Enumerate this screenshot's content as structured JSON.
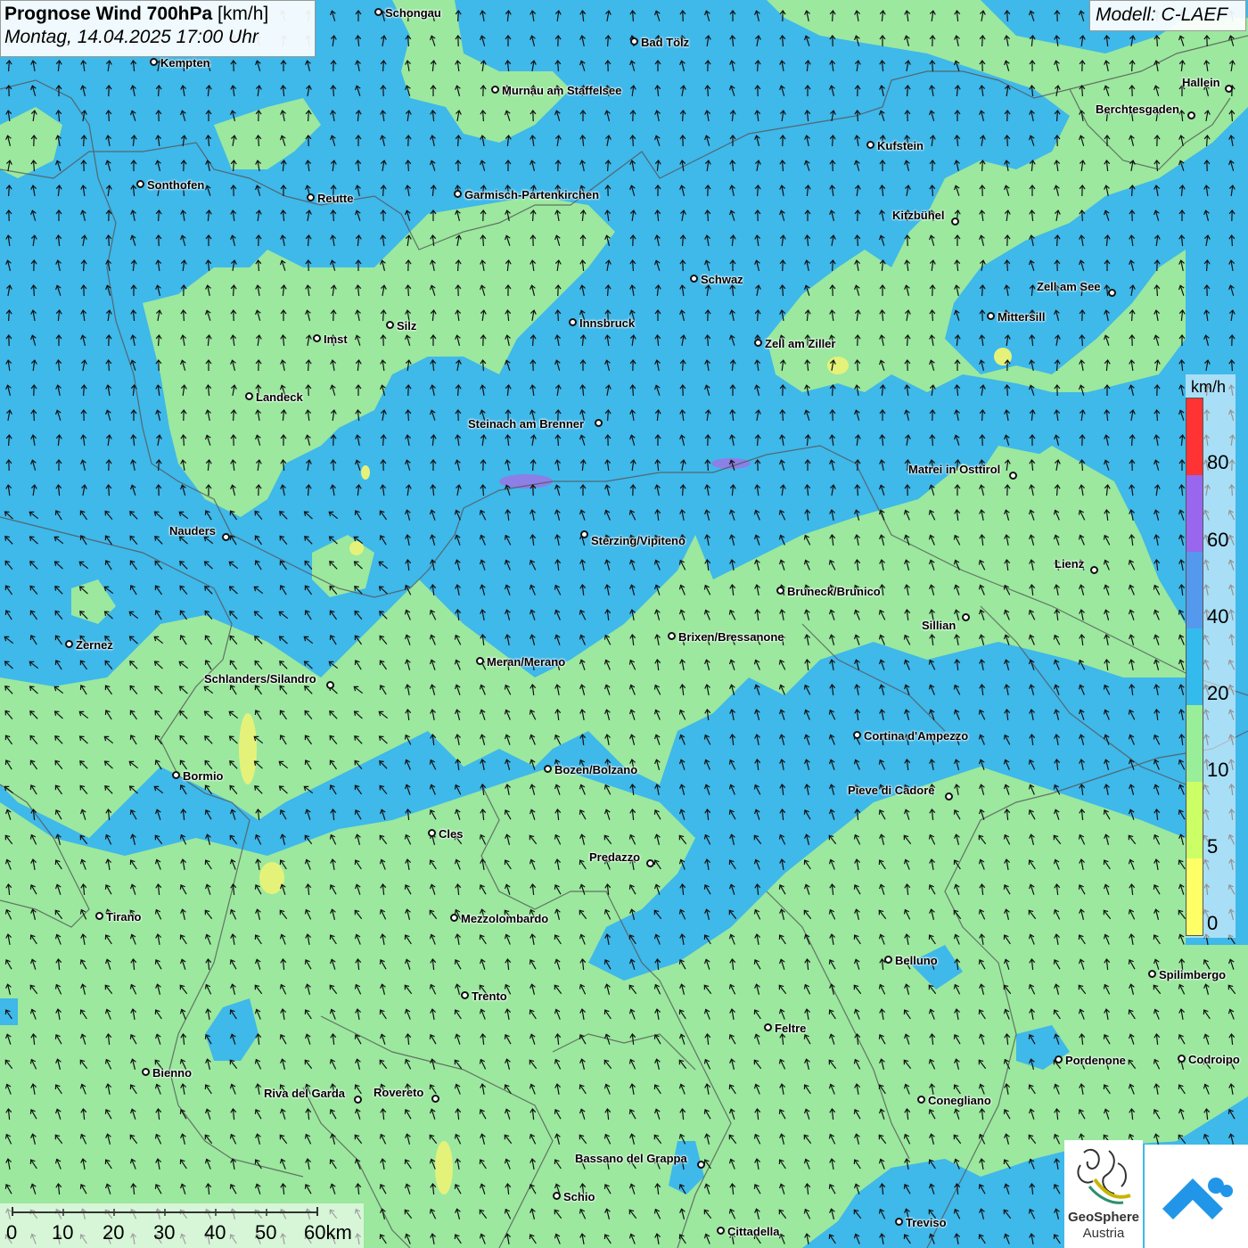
{
  "header": {
    "title_bold": "Prognose Wind 700hPa",
    "title_unit": " [km/h]",
    "subtitle": "Montag, 14.04.2025 17:00 Uhr"
  },
  "model": "Modell: C-LAEF",
  "legend": {
    "unit": "km/h",
    "ticks": [
      "0",
      "5",
      "10",
      "20",
      "40",
      "60",
      "80"
    ],
    "colors": [
      "#ffff66",
      "#ccff66",
      "#99ee99",
      "#33bbee",
      "#5599ee",
      "#9966ee",
      "#ff3333"
    ]
  },
  "scale": {
    "labels": [
      "0",
      "10",
      "20",
      "30",
      "40",
      "50",
      "60km"
    ]
  },
  "logo": {
    "name": "GeoSphere",
    "sub": "Austria"
  },
  "colors": {
    "water_blue": "#3fb8ea",
    "green_zone": "#9be89e",
    "yellow_zone": "#e5f27a",
    "purple_zone": "#7f7fe6",
    "border": "#555555"
  },
  "cities": [
    {
      "name": "Schongau"
    },
    {
      "name": "Bad Tölz"
    },
    {
      "name": "Kempten"
    },
    {
      "name": "Murnau am Staffelsee"
    },
    {
      "name": "Hallein"
    },
    {
      "name": "Berchtesgaden"
    },
    {
      "name": "Kufstein"
    },
    {
      "name": "Sonthofen"
    },
    {
      "name": "Reutte"
    },
    {
      "name": "Garmisch-Partenkirchen"
    },
    {
      "name": "Kitzbühel"
    },
    {
      "name": "Schwaz"
    },
    {
      "name": "Zell am See"
    },
    {
      "name": "Mittersill"
    },
    {
      "name": "Silz"
    },
    {
      "name": "Innsbruck"
    },
    {
      "name": "Imst"
    },
    {
      "name": "Zell am Ziller"
    },
    {
      "name": "Landeck"
    },
    {
      "name": "Steinach am Brenner"
    },
    {
      "name": "Matrei in Osttirol"
    },
    {
      "name": "Nauders"
    },
    {
      "name": "Sterzing/Vipiteno"
    },
    {
      "name": "Lienz"
    },
    {
      "name": "Bruneck/Brunico"
    },
    {
      "name": "Sillian"
    },
    {
      "name": "Zernez"
    },
    {
      "name": "Brixen/Bressanone"
    },
    {
      "name": "Meran/Merano"
    },
    {
      "name": "Schlanders/Silandro"
    },
    {
      "name": "Cortina d'Ampezzo"
    },
    {
      "name": "Bozen/Bolzano"
    },
    {
      "name": "Bormio"
    },
    {
      "name": "Pieve di Cadore"
    },
    {
      "name": "Cles"
    },
    {
      "name": "Predazzo"
    },
    {
      "name": "Tirano"
    },
    {
      "name": "Mezzolombardo"
    },
    {
      "name": "Belluno"
    },
    {
      "name": "Spilimbergo"
    },
    {
      "name": "Trento"
    },
    {
      "name": "Feltre"
    },
    {
      "name": "Pordenone"
    },
    {
      "name": "Codroipo"
    },
    {
      "name": "Bienno"
    },
    {
      "name": "Riva del Garda"
    },
    {
      "name": "Rovereto"
    },
    {
      "name": "Conegliano"
    },
    {
      "name": "Bassano del Grappa"
    },
    {
      "name": "Schio"
    },
    {
      "name": "Treviso"
    },
    {
      "name": "Cittadella"
    }
  ]
}
